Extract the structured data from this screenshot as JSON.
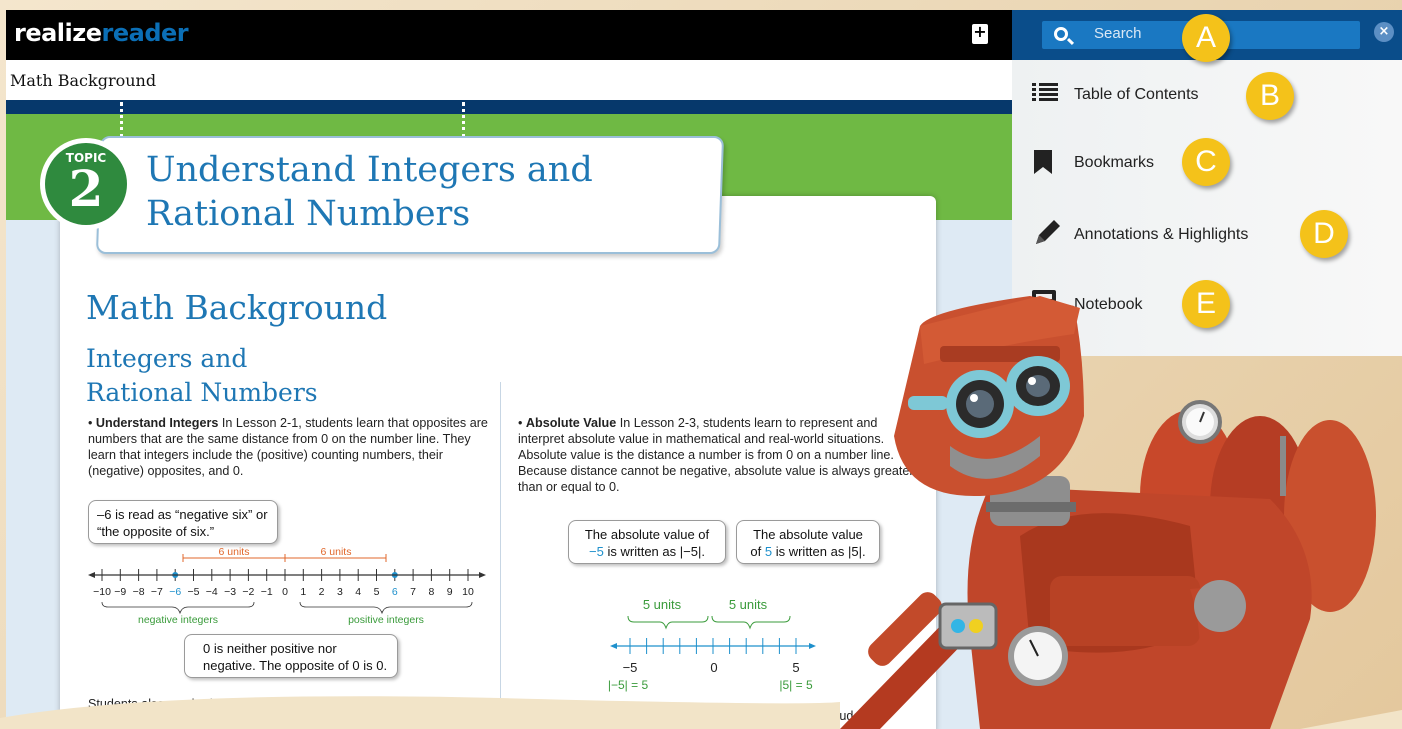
{
  "topbar": {
    "logo_part1": "realize",
    "logo_part2": "reader",
    "bookmark_add_icon": "bookmark-plus-icon"
  },
  "page_header": {
    "title": "Math Background"
  },
  "topic": {
    "badge_label": "TOPIC",
    "badge_number": "2",
    "title_line1": "Understand Integers and",
    "title_line2": "Rational Numbers"
  },
  "content": {
    "heading": "Math Background",
    "subheading_line1": "Integers and",
    "subheading_line2": "Rational Numbers",
    "left": {
      "lead": "Understand Integers",
      "body": "In Lesson 2-1, students learn that opposites are numbers that are the same distance from 0 on the number line. They learn that integers include the (positive) counting numbers, their (negative) opposites, and 0.",
      "callout_neg6": "–6 is read as “negative six” or “the opposite of six.”",
      "callout_zero": "0 is neither positive nor negative. The opposite of 0 is 0.",
      "bottom": "Students also use horizontal and vertical number lines in real-world contexts to understand positive and negative numbers."
    },
    "right": {
      "lead": "Absolute Value",
      "body": "In Lesson 2-3, students learn to represent and interpret absolute value in mathematical and real-world situations. Absolute value is the distance a number is from 0 on a number line. Because distance cannot be negative, absolute value is always greater than or equal to 0.",
      "callout_neg5_prefix": "The absolute value of",
      "callout_neg5_value": "−5",
      "callout_neg5_suffix": "is written as",
      "callout_neg5_notation": "|−5|",
      "callout_5_prefix": "The absolute value",
      "callout_5_of": "of",
      "callout_5_value": "5",
      "callout_5_suffix": "is written as",
      "callout_5_notation": "|5|",
      "bottom": "Students also learn that absolute value represents magnitude and learn to interpret comparisons of"
    },
    "number_line_left": {
      "ticks": [
        "−10",
        "−9",
        "−8",
        "−7",
        "−6",
        "−5",
        "−4",
        "−3",
        "−2",
        "−1",
        "0",
        "1",
        "2",
        "3",
        "4",
        "5",
        "6",
        "7",
        "8",
        "9",
        "10"
      ],
      "units_left": "6 units",
      "units_right": "6 units",
      "neg_label": "negative integers",
      "pos_label": "positive integers"
    },
    "number_line_right": {
      "units_left": "5 units",
      "units_right": "5 units",
      "tick_neg5": "−5",
      "tick_0": "0",
      "tick_5": "5",
      "eq_left": "|−5| = 5",
      "eq_right": "|5| = 5"
    }
  },
  "menu": {
    "search_placeholder": "Search",
    "items": [
      {
        "label": "Table of Contents",
        "icon": "list-icon"
      },
      {
        "label": "Bookmarks",
        "icon": "bookmark-icon"
      },
      {
        "label": "Annotations & Highlights",
        "icon": "pencil-icon"
      },
      {
        "label": "Notebook",
        "icon": "notebook-icon"
      }
    ]
  },
  "markers": [
    "A",
    "B",
    "C",
    "D",
    "E"
  ],
  "colors": {
    "accent_blue": "#1e77b4",
    "topbar": "#000000",
    "search_bar": "#0a4d8a",
    "marker": "#f4c21a",
    "green_band": "#6fb944"
  }
}
